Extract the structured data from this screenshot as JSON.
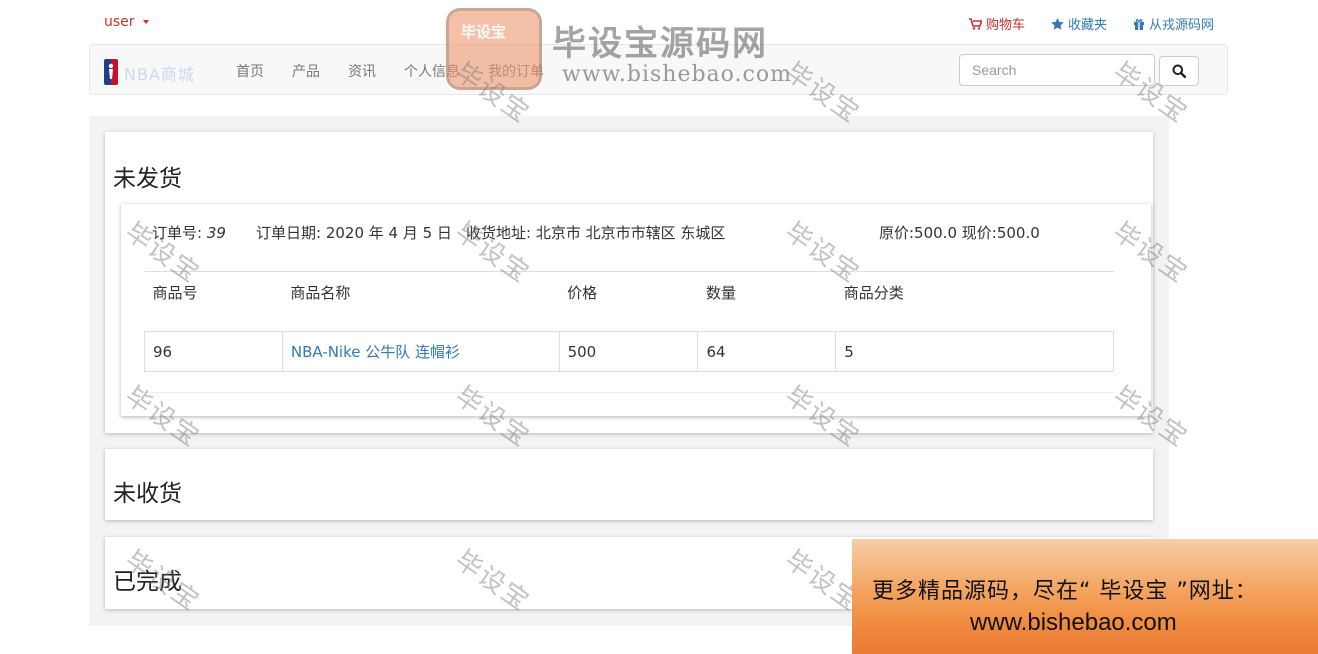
{
  "topbar": {
    "user_label": "user",
    "links": {
      "cart": "购物车",
      "favorites": "收藏夹",
      "external": "从戎源码网"
    }
  },
  "navbar": {
    "brand_text": "NBA商城",
    "items": [
      "首页",
      "产品",
      "资讯",
      "个人信息",
      "我的订单"
    ],
    "search_placeholder": "Search"
  },
  "sections": {
    "unshipped": {
      "title": "未发货",
      "order": {
        "number_label": "订单号:",
        "number": "39",
        "date": "订单日期: 2020 年 4 月 5 日",
        "address": "收货地址: 北京市 北京市市辖区 东城区",
        "price": "原价:500.0 现价:500.0",
        "columns": [
          "商品号",
          "商品名称",
          "价格",
          "数量",
          "商品分类"
        ],
        "rows": [
          [
            "96",
            "NBA-Nike 公牛队 连帽衫",
            "500",
            "64",
            "5"
          ]
        ]
      }
    },
    "unreceived": {
      "title": "未收货"
    },
    "completed": {
      "title": "已完成"
    }
  },
  "watermark": {
    "text": "毕设宝",
    "logo_badge": "毕设宝",
    "logo_title": "毕设宝源码网",
    "logo_url": "www.bishebao.com"
  },
  "ad": {
    "line1": "更多精品源码，尽在“ 毕设宝 ”网址：",
    "line2": "www.bishebao.com"
  },
  "colors": {
    "accent_red": "#c9302c",
    "link_blue": "#337ab7",
    "navbar_bg": "#f8f8f8",
    "content_bg": "#f3f3f3"
  }
}
